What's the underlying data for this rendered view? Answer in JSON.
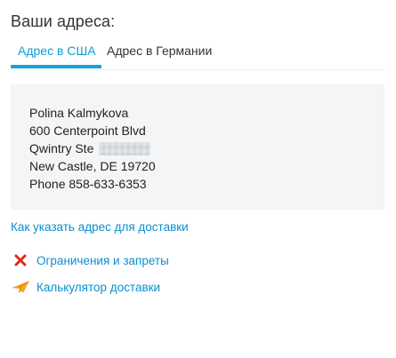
{
  "page": {
    "title": "Ваши адреса:"
  },
  "tabs": [
    {
      "label": "Адрес в США",
      "active": true
    },
    {
      "label": "Адрес в Германии",
      "active": false
    }
  ],
  "address": {
    "name": "Polina Kalmykova",
    "street": "600 Centerpoint Blvd",
    "suite_prefix": "Qwintry Ste",
    "city_line": "New Castle, DE 19720",
    "phone": "Phone 858-633-6353"
  },
  "links": {
    "how_to": "Как указать адрес для доставки",
    "restrictions": "Ограничения и запреты",
    "calculator": "Калькулятор доставки"
  },
  "icons": {
    "restrictions": "close-x-icon",
    "calculator": "paper-plane-icon"
  },
  "colors": {
    "accent": "#1aa1e0",
    "link": "#0a8fcf",
    "x_icon": "#e0291b",
    "plane_icon": "#f5a623",
    "box_bg": "#f4f5f7"
  }
}
